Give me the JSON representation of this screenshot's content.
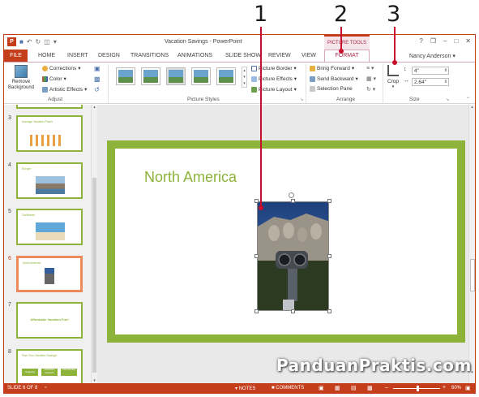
{
  "callouts": [
    "1",
    "2",
    "3"
  ],
  "window": {
    "title": "Vacation Savings - PowerPoint"
  },
  "winctl": {
    "help": "?",
    "restore": "❐",
    "min": "–",
    "max": "□",
    "close": "✕"
  },
  "qat": {
    "app_icon": "P",
    "save": "💾",
    "undo": "↶",
    "redo": "↻",
    "more": "▾"
  },
  "contextual_tab": "PICTURE TOOLS",
  "tabs": [
    "HOME",
    "INSERT",
    "DESIGN",
    "TRANSITIONS",
    "ANIMATIONS",
    "SLIDE SHOW",
    "REVIEW",
    "VIEW"
  ],
  "file_tab": "FILE",
  "format_tab": "FORMAT",
  "user": "Nancy Anderson",
  "ribbon": {
    "adjust": {
      "remove_background": "Remove Background",
      "corrections": "Corrections",
      "color": "Color",
      "artistic_effects": "Artistic Effects",
      "label": "Adjust"
    },
    "picture_styles": {
      "label": "Picture Styles",
      "border": "Picture Border",
      "effects": "Picture Effects",
      "layout": "Picture Layout"
    },
    "arrange": {
      "label": "Arrange",
      "bring_forward": "Bring Forward",
      "send_backward": "Send Backward",
      "selection_pane": "Selection Pane"
    },
    "size": {
      "label": "Size",
      "crop": "Crop",
      "height": "4\"",
      "width": "2.64\""
    }
  },
  "slides": [
    {
      "num": "3",
      "title": "Average Vacation Prices"
    },
    {
      "num": "4",
      "title": "Europe"
    },
    {
      "num": "5",
      "title": "Caribbean"
    },
    {
      "num": "6",
      "title": "North America"
    },
    {
      "num": "7",
      "title": "Affordable Vacation Fun!"
    },
    {
      "num": "8",
      "title": "Plan Your Vacation Savings",
      "boxes": [
        "Budgeting",
        "Destination Research",
        "Travel Booking"
      ]
    }
  ],
  "current_slide": {
    "title": "North America"
  },
  "status": {
    "slide_info": "SLIDE 6 OF 8",
    "notes": "NOTES",
    "comments": "COMMENTS",
    "zoom": "60%",
    "zoom_level": 0.6
  },
  "watermark": "PanduanPraktis.com",
  "colors": {
    "accent": "#c43e1c",
    "slide_green": "#8db33a",
    "context_pink": "#b0284a"
  }
}
